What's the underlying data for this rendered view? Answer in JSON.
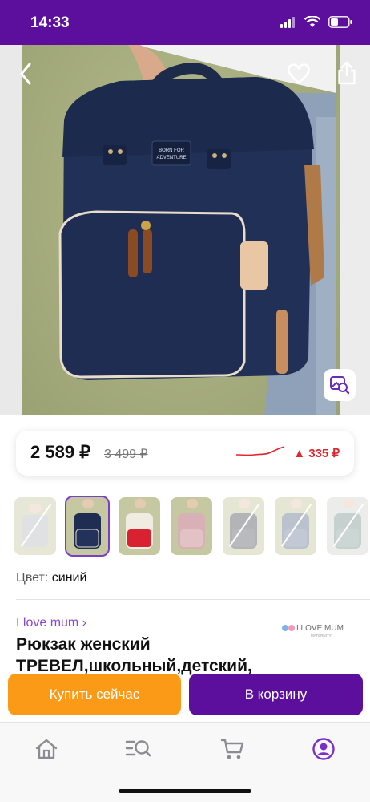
{
  "status_bar": {
    "time": "14:33"
  },
  "hero": {
    "back_icon": "chevron-left-icon",
    "favorite_icon": "heart-icon",
    "share_icon": "share-icon",
    "visual_search_icon": "image-search-icon"
  },
  "price": {
    "current": "2 589 ₽",
    "old": "3 499 ₽",
    "change": "▲ 335 ₽",
    "change_color": "#e0262f"
  },
  "thumbnails": [
    {
      "state": "unavailable"
    },
    {
      "state": "selected"
    },
    {
      "state": "available"
    },
    {
      "state": "available"
    },
    {
      "state": "unavailable"
    },
    {
      "state": "unavailable"
    },
    {
      "state": "unavailable"
    }
  ],
  "color": {
    "label": "Цвет:",
    "value": "синий"
  },
  "brand": {
    "link_text": "I love mum ›",
    "logo_text": "I LOVE MUM",
    "logo_sub": "MATERNITY"
  },
  "product": {
    "title": "Рюкзак женский ТРЕВЕЛ,школьный,детский,"
  },
  "actions": {
    "buy_now": "Купить сейчас",
    "add_to_cart": "В корзину"
  },
  "tabbar": {
    "items": [
      {
        "icon": "home-icon"
      },
      {
        "icon": "catalog-search-icon"
      },
      {
        "icon": "cart-icon"
      },
      {
        "icon": "profile-icon"
      }
    ]
  },
  "colors": {
    "brand_purple": "#5b0f9c",
    "accent_orange": "#fb9a16",
    "link_purple": "#8a46d6"
  }
}
